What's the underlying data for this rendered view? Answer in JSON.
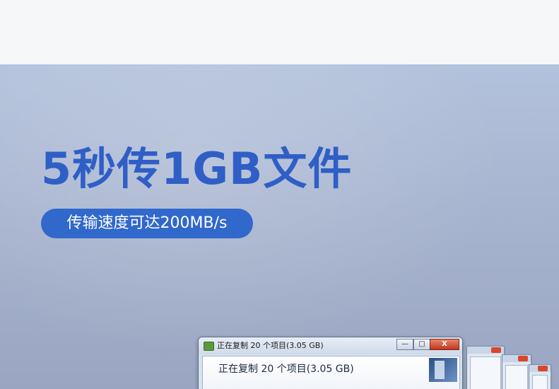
{
  "hero": {
    "headline": "5秒传1GB文件",
    "pill_text": "传输速度可达200MB/s"
  },
  "dialog": {
    "title": "正在复制 20 个项目(3.05 GB)",
    "content_text": "正在复制 20 个项目(3.05 GB)",
    "min_symbol": "—",
    "max_symbol": "□",
    "close_symbol": "X"
  },
  "colors": {
    "headline": "#2f5fc6",
    "pill": "#3068cc",
    "background_top": "#b3c2dc",
    "background_bottom": "#9aa6c1"
  }
}
